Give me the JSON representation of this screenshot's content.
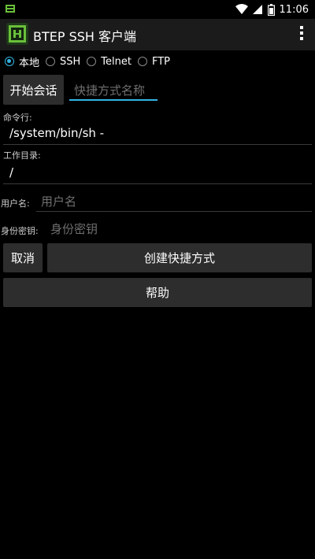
{
  "status_bar": {
    "time": "11:06",
    "icons": [
      "notification-icon",
      "wifi-icon",
      "signal-icon",
      "battery-icon"
    ]
  },
  "app_bar": {
    "title": "BTEP SSH 客户端",
    "icon": "app-logo-icon",
    "menu_icon": "overflow-menu-icon"
  },
  "connection_types": {
    "selected": "本地",
    "options": [
      "本地",
      "SSH",
      "Telnet",
      "FTP"
    ]
  },
  "session": {
    "start_label": "开始会话",
    "shortcut_name_placeholder": "快捷方式名称"
  },
  "form": {
    "command_label": "命令行:",
    "command_value": "/system/bin/sh -",
    "workdir_label": "工作目录:",
    "workdir_value": "/",
    "username_label": "用户名:",
    "username_placeholder": "用户名",
    "identity_label": "身份密钥:",
    "identity_placeholder": "身份密钥"
  },
  "actions": {
    "cancel_label": "取消",
    "create_shortcut_label": "创建快捷方式",
    "help_label": "帮助"
  },
  "colors": {
    "accent": "#33b5e5",
    "background": "#000000",
    "button": "#2d2d2d",
    "action_bar": "#1b1b1b"
  }
}
